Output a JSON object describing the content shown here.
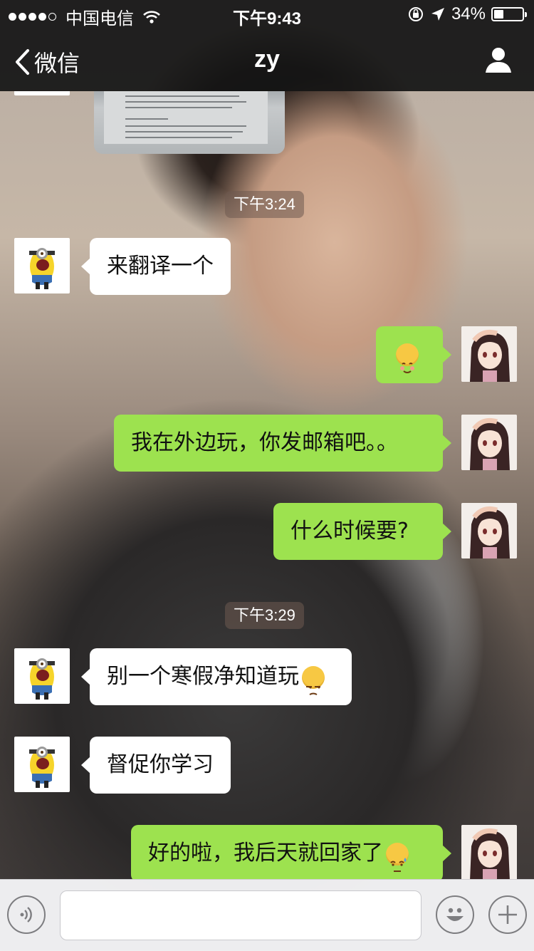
{
  "status_bar": {
    "carrier": "中国电信",
    "time": "下午9:43",
    "battery_percent_label": "34%",
    "battery_level": 0.34,
    "signal_bars_filled": 4,
    "signal_bars_total": 5
  },
  "nav": {
    "back_label": "微信",
    "title": "zy"
  },
  "messages": {
    "ts1": "下午3:24",
    "m1": "来翻译一个",
    "m3": "我在外边玩，你发邮箱吧。。",
    "m4": "什么时候要?",
    "ts2": "下午3:29",
    "m5": "别一个寒假净知道玩",
    "m6": "督促你学习",
    "m7": "好的啦，我后天就回家了"
  },
  "input": {
    "value": "",
    "placeholder": ""
  },
  "colors": {
    "outgoing_bubble": "#9de24f",
    "incoming_bubble": "#ffffff",
    "bars": "#141414"
  },
  "icons": [
    "signal-dots-icon",
    "wifi-icon",
    "orientation-lock-icon",
    "location-arrow-icon",
    "battery-icon",
    "chevron-left-icon",
    "person-icon",
    "voice-icon",
    "emoji-icon",
    "plus-icon"
  ]
}
